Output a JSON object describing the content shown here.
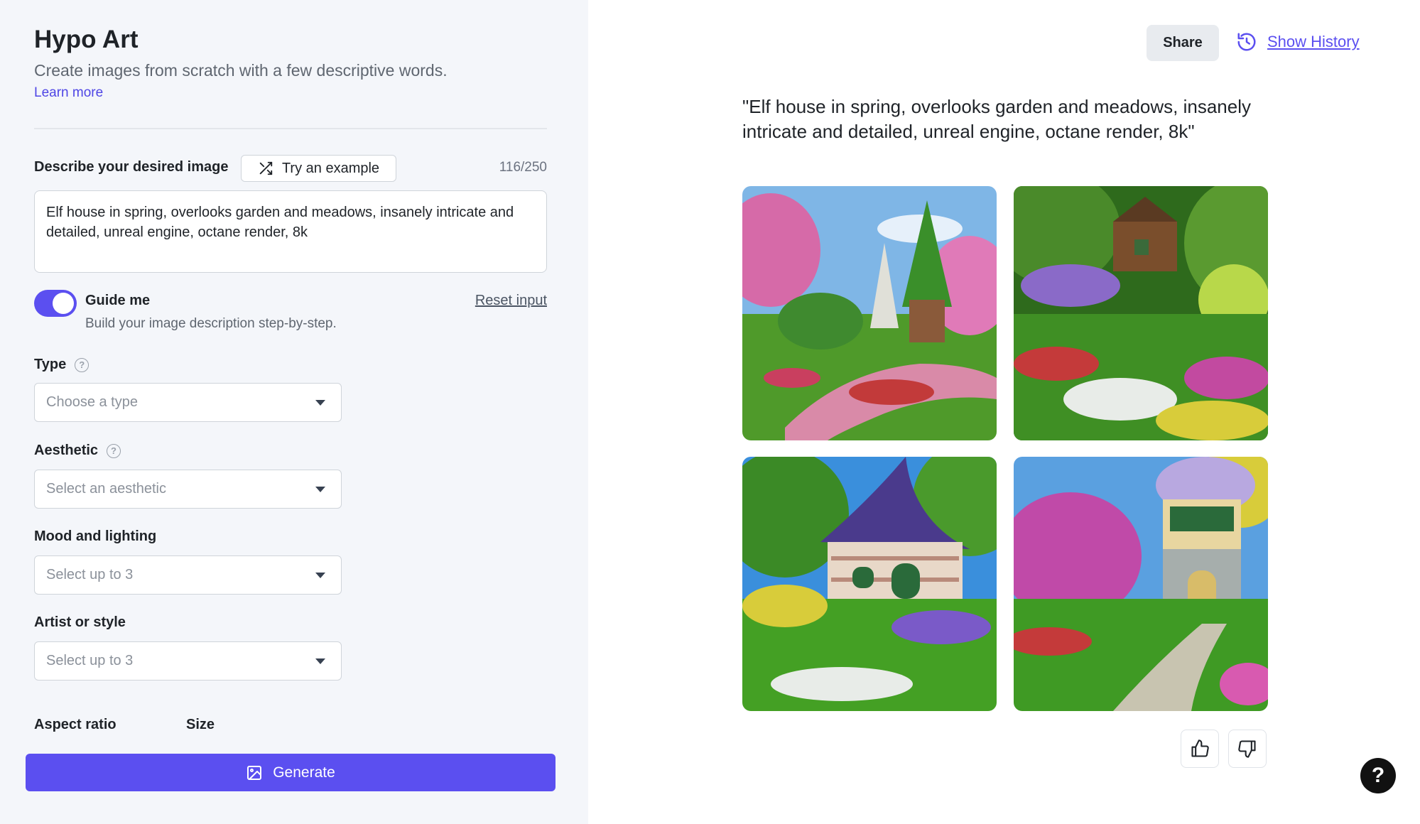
{
  "app": {
    "title": "Hypo Art",
    "subtitle": "Create images from scratch with a few descriptive words.",
    "learn_more": "Learn more"
  },
  "describe": {
    "label": "Describe your desired image",
    "try_example": "Try an example",
    "counter": "116/250",
    "value": "Elf house in spring, overlooks garden and meadows, insanely intricate and detailed, unreal engine, octane render, 8k"
  },
  "guide": {
    "title": "Guide me",
    "subtitle": "Build your image description step-by-step.",
    "reset": "Reset input",
    "enabled": true
  },
  "fields": {
    "type": {
      "label": "Type",
      "placeholder": "Choose a type"
    },
    "aesthetic": {
      "label": "Aesthetic",
      "placeholder": "Select an aesthetic"
    },
    "mood": {
      "label": "Mood and lighting",
      "placeholder": "Select up to 3"
    },
    "artist": {
      "label": "Artist or style",
      "placeholder": "Select up to 3"
    },
    "aspect_ratio": {
      "label": "Aspect ratio"
    },
    "size": {
      "label": "Size"
    }
  },
  "generate": {
    "label": "Generate"
  },
  "header": {
    "share": "Share",
    "show_history": "Show History"
  },
  "result": {
    "prompt": "\"Elf house in spring, overlooks garden and meadows, insanely intricate and detailed, unreal engine, octane render, 8k\""
  },
  "help": {
    "label": "?"
  },
  "colors": {
    "accent": "#5b4ff0",
    "panel_bg": "#f4f6fa"
  }
}
